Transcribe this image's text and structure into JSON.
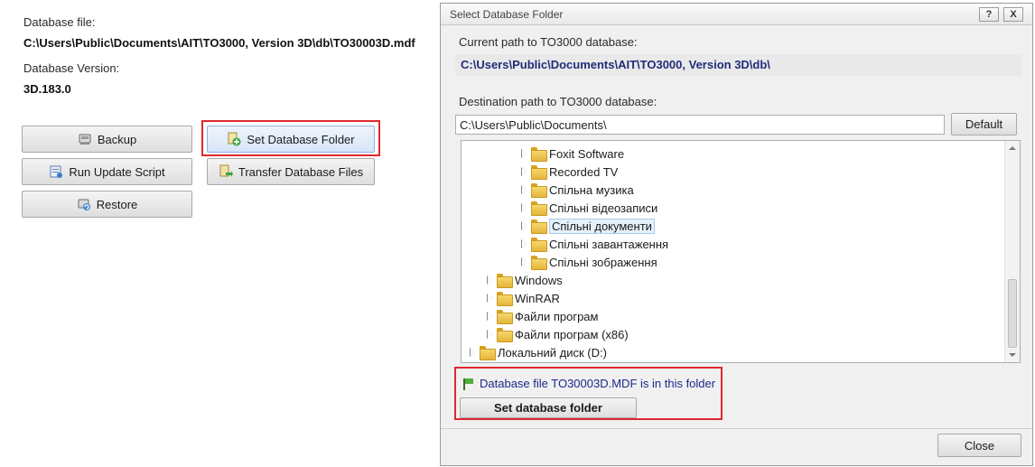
{
  "left_panel": {
    "db_file_label": "Database file:",
    "db_file_value": "C:\\Users\\Public\\Documents\\AIT\\TO3000, Version 3D\\db\\TO30003D.mdf",
    "db_version_label": "Database Version:",
    "db_version_value": "3D.183.0",
    "buttons": {
      "backup": "Backup",
      "set_folder": "Set Database Folder",
      "run_update": "Run Update Script",
      "transfer": "Transfer Database Files",
      "restore": "Restore"
    }
  },
  "dialog": {
    "title": "Select Database Folder",
    "help_btn": "?",
    "close_btn": "X",
    "current_path_label": "Current path to TO3000 database:",
    "current_path_value": "C:\\Users\\Public\\Documents\\AIT\\TO3000, Version 3D\\db\\",
    "dest_path_label": "Destination path to TO3000 database:",
    "dest_path_value": "C:\\Users\\Public\\Documents\\",
    "default_button": "Default",
    "tree": [
      {
        "label": "Foxit Software"
      },
      {
        "label": "Recorded TV"
      },
      {
        "label": "Спільна музика"
      },
      {
        "label": "Спільні відеозаписи"
      },
      {
        "label": "Спільні документи",
        "selected": true
      },
      {
        "label": "Спільні завантаження"
      },
      {
        "label": "Спільні зображення"
      },
      {
        "label": "Windows"
      },
      {
        "label": "WinRAR"
      },
      {
        "label": "Файли програм"
      },
      {
        "label": "Файли програм (x86)"
      },
      {
        "label": "Локальний диск (D:)"
      }
    ],
    "status_message": "Database file TO30003D.MDF is in this folder",
    "set_folder_button": "Set database folder",
    "close_button": "Close"
  },
  "colors": {
    "highlight_box": "#e0282e",
    "path_text": "#1f2e78",
    "status_text": "#1a2a8a"
  }
}
